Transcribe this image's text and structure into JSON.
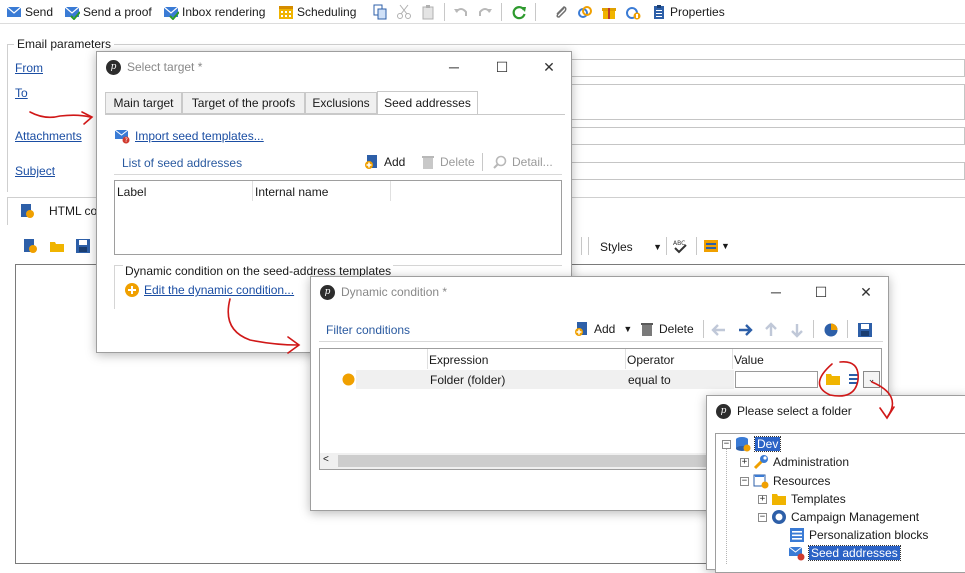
{
  "toolbar": {
    "send": "Send",
    "send_proof": "Send a proof",
    "inbox_rendering": "Inbox rendering",
    "scheduling": "Scheduling",
    "properties": "Properties"
  },
  "email_params": {
    "title": "Email parameters",
    "from": "From",
    "to": "To",
    "attachments": "Attachments",
    "subject": "Subject"
  },
  "html_tab": {
    "label": "HTML co"
  },
  "editor_toolbar": {
    "styles": "Styles"
  },
  "select_target": {
    "title": "Select target *",
    "tabs": [
      "Main target",
      "Target of the proofs",
      "Exclusions",
      "Seed addresses"
    ],
    "import_link": "Import seed templates...",
    "list_title": "List of seed addresses",
    "add": "Add",
    "delete": "Delete",
    "detail": "Detail...",
    "columns": [
      "Label",
      "Internal name"
    ],
    "dynamic_group": "Dynamic condition on the seed-address templates",
    "edit_link": "Edit the dynamic condition..."
  },
  "dynamic_condition": {
    "title": "Dynamic condition *",
    "filter_title": "Filter conditions",
    "add": "Add",
    "delete": "Delete",
    "columns": [
      "Expression",
      "Operator",
      "Value"
    ],
    "row": {
      "expression": "Folder (folder)",
      "operator": "equal to",
      "value": ""
    }
  },
  "folder_picker": {
    "title": "Please select a folder",
    "tree": [
      "Dev",
      "Administration",
      "Resources",
      "Templates",
      "Campaign Management",
      "Personalization blocks",
      "Seed addresses"
    ]
  },
  "colors": {
    "accent": "#1b4ea3",
    "annotation": "#d01818",
    "selection": "#2b63c6"
  }
}
